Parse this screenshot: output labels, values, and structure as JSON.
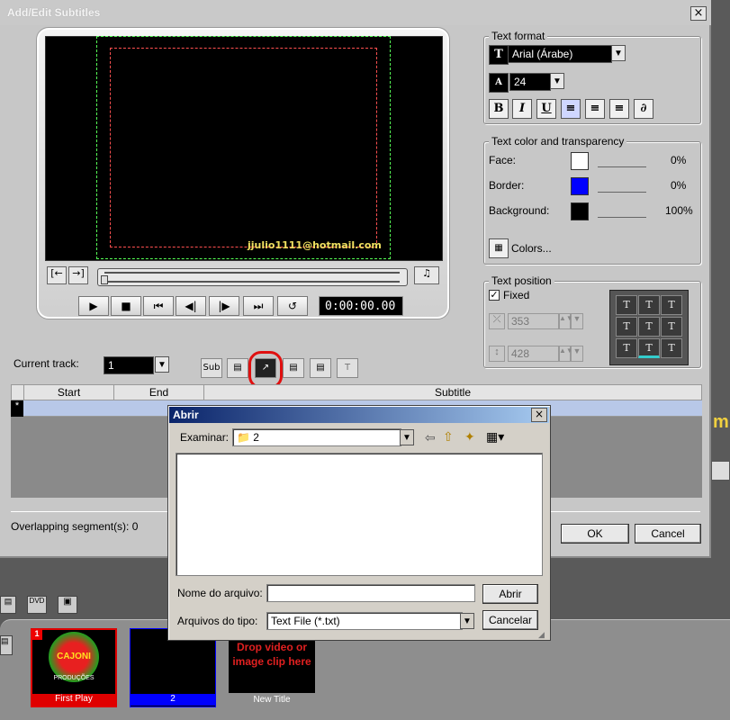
{
  "dialog": {
    "title": "Add/Edit Subtitles",
    "close": "×"
  },
  "preview": {
    "email_text": "jjulio1111@hotmail.com",
    "timecode": "0:00:00.00",
    "transport": [
      "▶",
      "■",
      "⏮",
      "◀|",
      "|▶",
      "⏭",
      "↺"
    ],
    "left_btns": [
      "[←",
      "→]"
    ]
  },
  "text_format": {
    "legend": "Text format",
    "font": "Arial (Árabe)",
    "size": "24",
    "buttons": [
      "B",
      "I",
      "U",
      "≡",
      "≡",
      "≡",
      "∂"
    ]
  },
  "text_color": {
    "legend": "Text color and transparency",
    "rows": [
      {
        "label": "Face:",
        "color": "#ffffff",
        "value": "0%"
      },
      {
        "label": "Border:",
        "color": "#0000ff",
        "value": "0%"
      },
      {
        "label": "Background:",
        "color": "#000000",
        "value": "100%"
      }
    ],
    "colors_btn": "Colors..."
  },
  "text_position": {
    "legend": "Text position",
    "fixed_label": "Fixed",
    "x_value": "353",
    "y_value": "428"
  },
  "track": {
    "label": "Current track:",
    "value": "1"
  },
  "grid": {
    "headers": [
      "Start",
      "End",
      "Subtitle"
    ],
    "row_marker": "*"
  },
  "status": "Overlapping segment(s): 0",
  "ok_label": "OK",
  "cancel_label": "Cancel",
  "open_dialog": {
    "title": "Abrir",
    "lookin_label": "Examinar:",
    "lookin_value": "2",
    "filename_label": "Nome do arquivo:",
    "filename_value": "",
    "filetype_label": "Arquivos do tipo:",
    "filetype_value": "Text File (*.txt)",
    "open_btn": "Abrir",
    "cancel_btn": "Cancelar"
  },
  "timeline": {
    "clip1_label": "First Play",
    "clip1_badge": "1",
    "clip1_logo": "CAJONI",
    "clip1_sub": "PRODUÇÕES",
    "clip2_label": "2",
    "drop_text": "Drop video or image clip here",
    "new_title": "New Title"
  },
  "bg_fragment": "m"
}
